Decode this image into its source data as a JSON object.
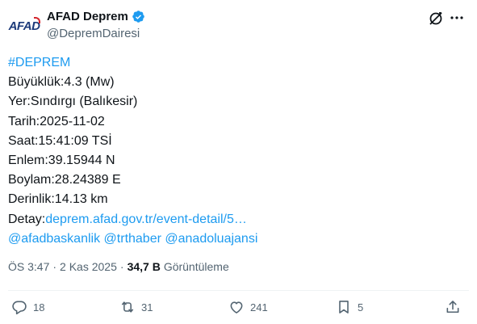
{
  "author": {
    "avatar_text": "AFAD",
    "display_name": "AFAD Deprem",
    "handle": "@DepremDairesi"
  },
  "tweet": {
    "hashtag": "#DEPREM",
    "lines": {
      "magnitude": "Büyüklük:4.3 (Mw)",
      "place": "Yer:Sındırgı (Balıkesir)",
      "date": "Tarih:2025-11-02",
      "time": "Saat:15:41:09 TSİ",
      "lat": "Enlem:39.15944 N",
      "lon": "Boylam:28.24389 E",
      "depth": "Derinlik:14.13 km",
      "detail_label": "Detay:",
      "detail_link": "deprem.afad.gov.tr/event-detail/5…"
    },
    "mentions": [
      "@afadbaskanlik",
      "@trthaber",
      "@anadoluajansi"
    ]
  },
  "meta": {
    "time": "ÖS 3:47",
    "separator": "·",
    "date": "2 Kas 2025",
    "views_count": "34,7 B",
    "views_label": "Görüntüleme"
  },
  "actions": {
    "replies": "18",
    "reposts": "31",
    "likes": "241",
    "bookmarks": "5"
  },
  "colors": {
    "link": "#1d9bf0",
    "text": "#0f1419",
    "secondary": "#536471",
    "verified": "#1d9bf0"
  }
}
